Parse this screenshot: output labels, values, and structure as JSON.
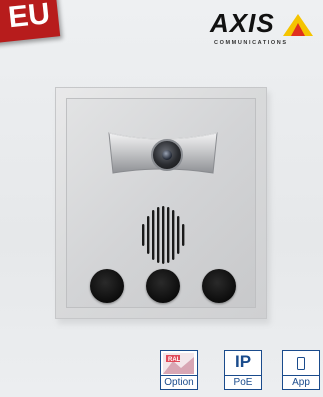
{
  "badge": {
    "text": "EU"
  },
  "brand": {
    "name": "AXIS",
    "tagline": "COMMUNICATIONS",
    "accent_color": "#f5c400"
  },
  "features": [
    {
      "label": "Option",
      "icon": "option-image-icon"
    },
    {
      "label": "PoE",
      "header": "IP",
      "icon": "ip-text-icon"
    },
    {
      "label": "App",
      "icon": "smartphone-icon"
    }
  ],
  "colors": {
    "feature_border": "#1a4b8c",
    "badge_bg": "#b71c1c"
  }
}
